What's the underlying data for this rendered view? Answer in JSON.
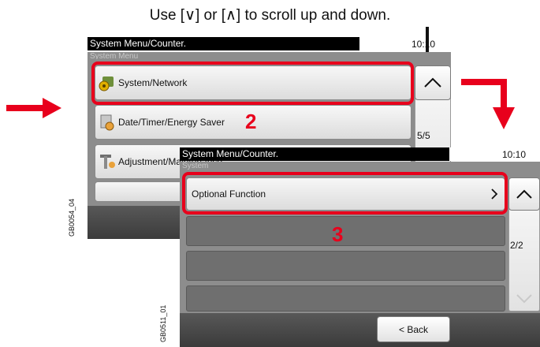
{
  "instruction": "Use [∨] or [∧] to scroll up and down.",
  "screen1": {
    "title": "System Menu/Counter.",
    "time": "10:10",
    "subtitle": "System Menu",
    "items": [
      {
        "label": "System/Network",
        "icon": "system-network-icon"
      },
      {
        "label": "Date/Timer/Energy Saver",
        "icon": "date-timer-icon"
      },
      {
        "label": "Adjustment/Maintenance",
        "icon": "adjustment-icon"
      }
    ],
    "page_indicator": "5/5",
    "step": "2",
    "code": "GB0054_04"
  },
  "screen2": {
    "title": "System Menu/Counter.",
    "time": "10:10",
    "subtitle": "System",
    "items": [
      {
        "label": "Optional Function"
      }
    ],
    "page_indicator": "2/2",
    "step": "3",
    "back_label": "< Back",
    "code": "GB0511_01"
  },
  "colors": {
    "highlight": "#e8001c",
    "title_bar": "#000000",
    "panel_gray": "#8d8d8d"
  }
}
